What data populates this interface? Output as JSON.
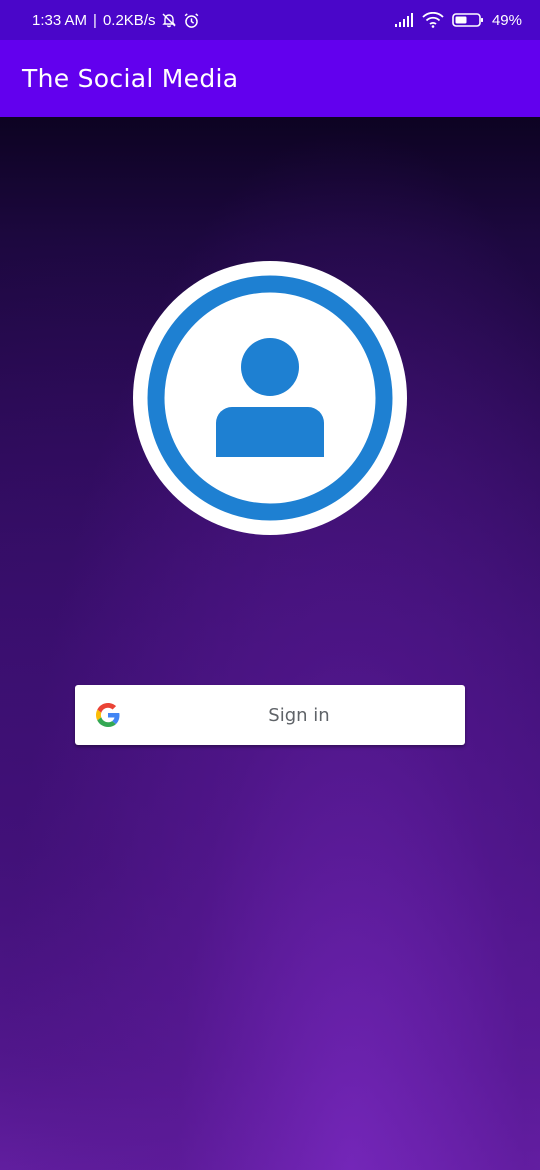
{
  "status_bar": {
    "time": "1:33 AM",
    "network_speed": "0.2KB/s",
    "battery_percent": "49%",
    "icons": [
      "mute-bell-icon",
      "alarm-icon",
      "signal-icon",
      "wifi-icon",
      "battery-icon"
    ]
  },
  "app_bar": {
    "title": "The Social Media",
    "color": "#6200ee"
  },
  "profile": {
    "icon": "person-icon",
    "ring_color": "#1e80d2"
  },
  "signin": {
    "label": "Sign in",
    "icon": "google-icon"
  }
}
